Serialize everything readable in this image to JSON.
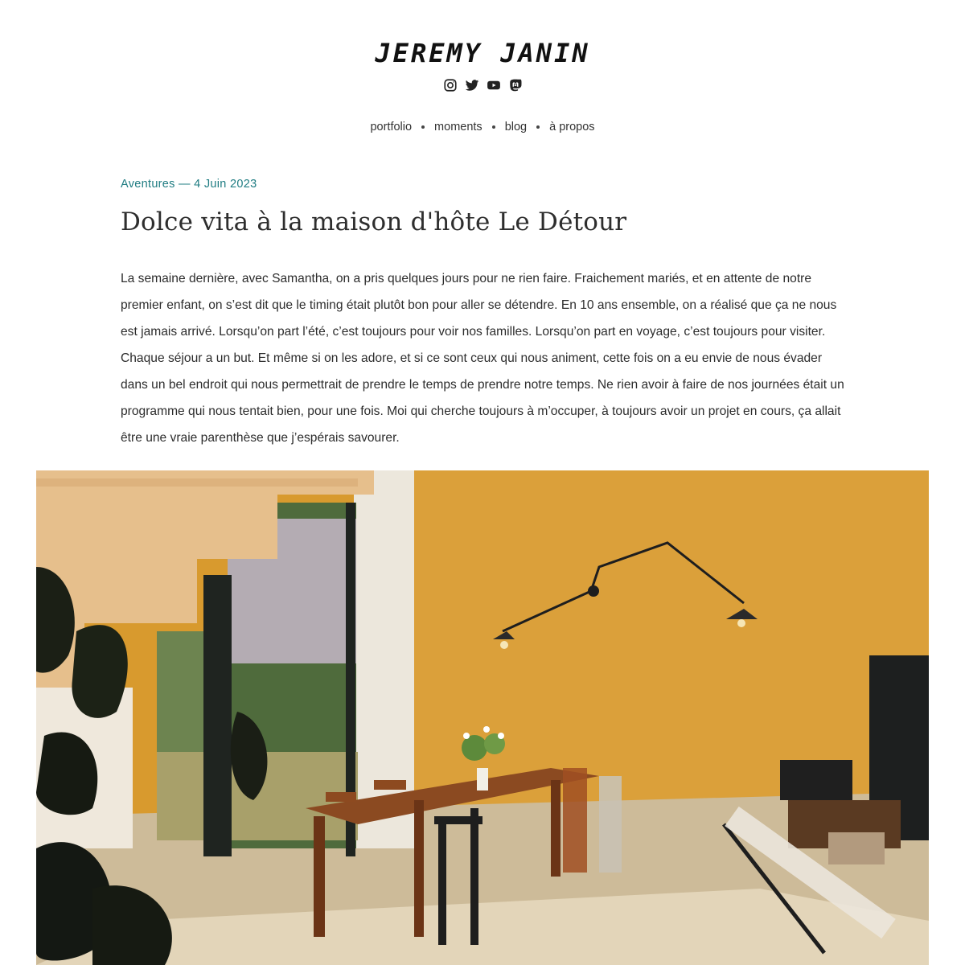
{
  "site": {
    "logo_text": "JEREMY JANIN"
  },
  "socials": [
    {
      "icon": "instagram-icon"
    },
    {
      "icon": "twitter-icon"
    },
    {
      "icon": "youtube-icon"
    },
    {
      "icon": "mastodon-icon"
    }
  ],
  "nav": {
    "items": [
      {
        "label": "portfolio"
      },
      {
        "label": "moments"
      },
      {
        "label": "blog"
      },
      {
        "label": "à propos"
      }
    ]
  },
  "post": {
    "meta": "Aventures — 4 Juin 2023",
    "title": "Dolce vita à la maison d'hôte Le Détour",
    "body": "La semaine dernière, avec Samantha, on a pris quelques jours pour ne rien faire. Fraichement mariés, et en attente de notre premier enfant, on s’est dit que le timing était plutôt bon pour aller se détendre. En 10 ans ensemble, on a réalisé que ça ne nous est jamais arrivé. Lorsqu’on part l’été, c’est toujours pour voir nos familles. Lorsqu’on part en voyage, c’est toujours pour visiter. Chaque séjour a un but. Et même si on les adore, et si ce sont ceux qui nous animent, cette fois on a eu envie de nous évader dans un bel endroit qui nous permettrait de prendre le temps de prendre notre temps. Ne rien avoir à faire de nos journées était un programme qui nous tentait bien, pour une fois. Moi qui cherche toujours à m’occuper, à toujours avoir un projet en cours, ça allait être une vraie parenthèse que j’espérais savourer."
  },
  "colors": {
    "accent": "#1f7c82",
    "wall": "#d99a2c"
  }
}
